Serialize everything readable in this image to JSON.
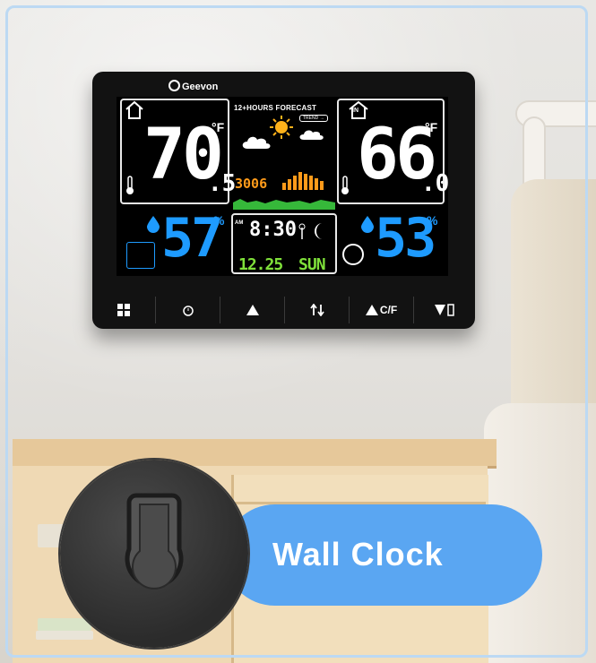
{
  "device": {
    "brand": "Geevon",
    "forecast_label": "12+HOURS FORECAST",
    "trend_label": "TREND →",
    "outdoor_temp": "70",
    "outdoor_temp_decimal": ".5",
    "outdoor_unit": "°F",
    "indoor_temp": "66",
    "indoor_temp_decimal": ".0",
    "indoor_unit": "°F",
    "indoor_tag": "IN",
    "outdoor_humidity": "57",
    "indoor_humidity": "53",
    "humidity_unit": "%",
    "pressure": "3006",
    "am_label": "AM",
    "time": "8:30",
    "date": "12.25",
    "weekday": "SUN",
    "buttons": [
      "",
      "",
      "",
      "",
      "C/F",
      ""
    ]
  },
  "callout": {
    "label": "Wall Clock"
  },
  "colors": {
    "accent_blue": "#5aa6f2",
    "lcd_blue": "#1e9bff",
    "lcd_orange": "#ff9b1a",
    "lcd_green": "#7fe03a"
  },
  "icons": [
    "sun-icon",
    "cloud-icon",
    "moon-icon",
    "droplet-icon",
    "thermometer-icon",
    "house-icon",
    "keyhole-mount-icon",
    "alarm-icon",
    "alert-icon",
    "arrows-icon",
    "up-triangle-icon",
    "down-triangle-icon",
    "menu-grid-icon"
  ]
}
